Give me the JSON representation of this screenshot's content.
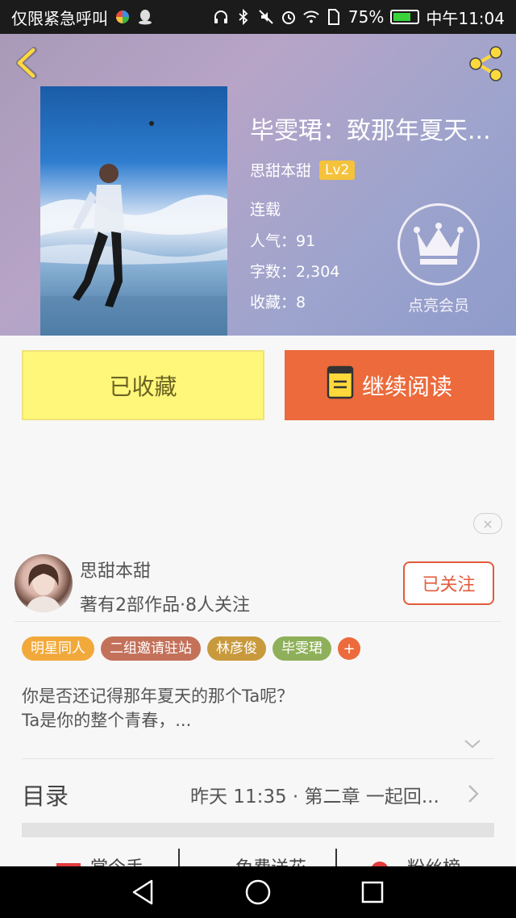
{
  "status_bar": {
    "left_text": "仅限紧急呼叫",
    "battery_text": "75%",
    "time": "中午11:04",
    "icons": [
      "colorful-app-icon",
      "qq-icon",
      "headphones-icon",
      "bluetooth-icon",
      "mute-icon",
      "alarm-icon",
      "wifi-icon",
      "sim-icon",
      "battery-icon"
    ]
  },
  "header": {
    "back_icon": "chevron-left-icon",
    "share_icon": "share-icon"
  },
  "book": {
    "title": "毕雯珺：致那年夏天...",
    "author": "思甜本甜",
    "level": "Lv2",
    "status": "连载",
    "popularity": "人气：91",
    "word_count": "字数：2,304",
    "favorites": "收藏：8"
  },
  "vip": {
    "icon": "crown-icon",
    "label": "点亮会员"
  },
  "actions": {
    "collected_label": "已收藏",
    "read_label": "继续阅读",
    "read_icon": "book-icon"
  },
  "ad": {
    "close_label": "×"
  },
  "author_card": {
    "name": "思甜本甜",
    "stats": "著有2部作品·8人关注",
    "follow_label": "已关注"
  },
  "tags": [
    {
      "label": "明星同人",
      "color": "#f2a93b"
    },
    {
      "label": "二组邀请驻站",
      "color": "#c4715a"
    },
    {
      "label": "林彦俊",
      "color": "#c89a3d"
    },
    {
      "label": "毕雯珺",
      "color": "#8fb05a"
    }
  ],
  "tag_add_label": "+",
  "description": {
    "line1": "你是否还记得那年夏天的那个Ta呢？",
    "line2": "Ta是你的整个青春，..."
  },
  "toc": {
    "label": "目录",
    "latest": "昨天 11:35 · 第二章  一起回..."
  },
  "bottom_tabs": {
    "tab1": "掌今手",
    "tab2": "免费送花",
    "tab3": "粉丝榜"
  },
  "colors": {
    "accent": "#ec6a3b",
    "collected_bg": "#fff77a",
    "follow_border": "#e25b3b"
  }
}
